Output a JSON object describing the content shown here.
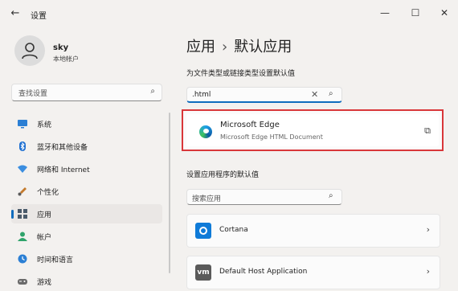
{
  "window": {
    "title": "设置",
    "back_glyph": "←",
    "minimize_glyph": "—",
    "maximize_glyph": "☐",
    "close_glyph": "✕"
  },
  "profile": {
    "name": "sky",
    "account_type": "本地帐户"
  },
  "sidebar": {
    "search_placeholder": "查找设置",
    "items": [
      {
        "label": "系统",
        "icon": "monitor-icon",
        "color": "#2b7fd4"
      },
      {
        "label": "蓝牙和其他设备",
        "icon": "bluetooth-icon",
        "color": "#1d6fd1"
      },
      {
        "label": "网络和 Internet",
        "icon": "wifi-icon",
        "color": "#3b8ee0"
      },
      {
        "label": "个性化",
        "icon": "brush-icon",
        "color": "#c47a2c"
      },
      {
        "label": "应用",
        "icon": "apps-icon",
        "color": "#4a5a6a",
        "active": true
      },
      {
        "label": "帐户",
        "icon": "person-icon",
        "color": "#2fa36b"
      },
      {
        "label": "时间和语言",
        "icon": "globe-clock-icon",
        "color": "#2b7fd4"
      },
      {
        "label": "游戏",
        "icon": "gamepad-icon",
        "color": "#6b6b6b"
      }
    ]
  },
  "main": {
    "breadcrumb_parent": "应用",
    "breadcrumb_separator": "›",
    "breadcrumb_current": "默认应用",
    "file_type_label": "为文件类型或链接类型设置默认值",
    "ext_input_value": ".html",
    "ext_clear_glyph": "✕",
    "edge_card": {
      "title": "Microsoft Edge",
      "subtitle": "Microsoft Edge HTML Document",
      "open_glyph": "⧉"
    },
    "app_defaults_label": "设置应用程序的默认值",
    "app_search_placeholder": "搜索应用",
    "apps": [
      {
        "label": "Cortana"
      },
      {
        "label": "Default Host Application",
        "icon_text": "vm"
      }
    ],
    "chevron_glyph": "›",
    "accent_color": "#0f6cbd",
    "highlight_color": "#d9373a"
  }
}
